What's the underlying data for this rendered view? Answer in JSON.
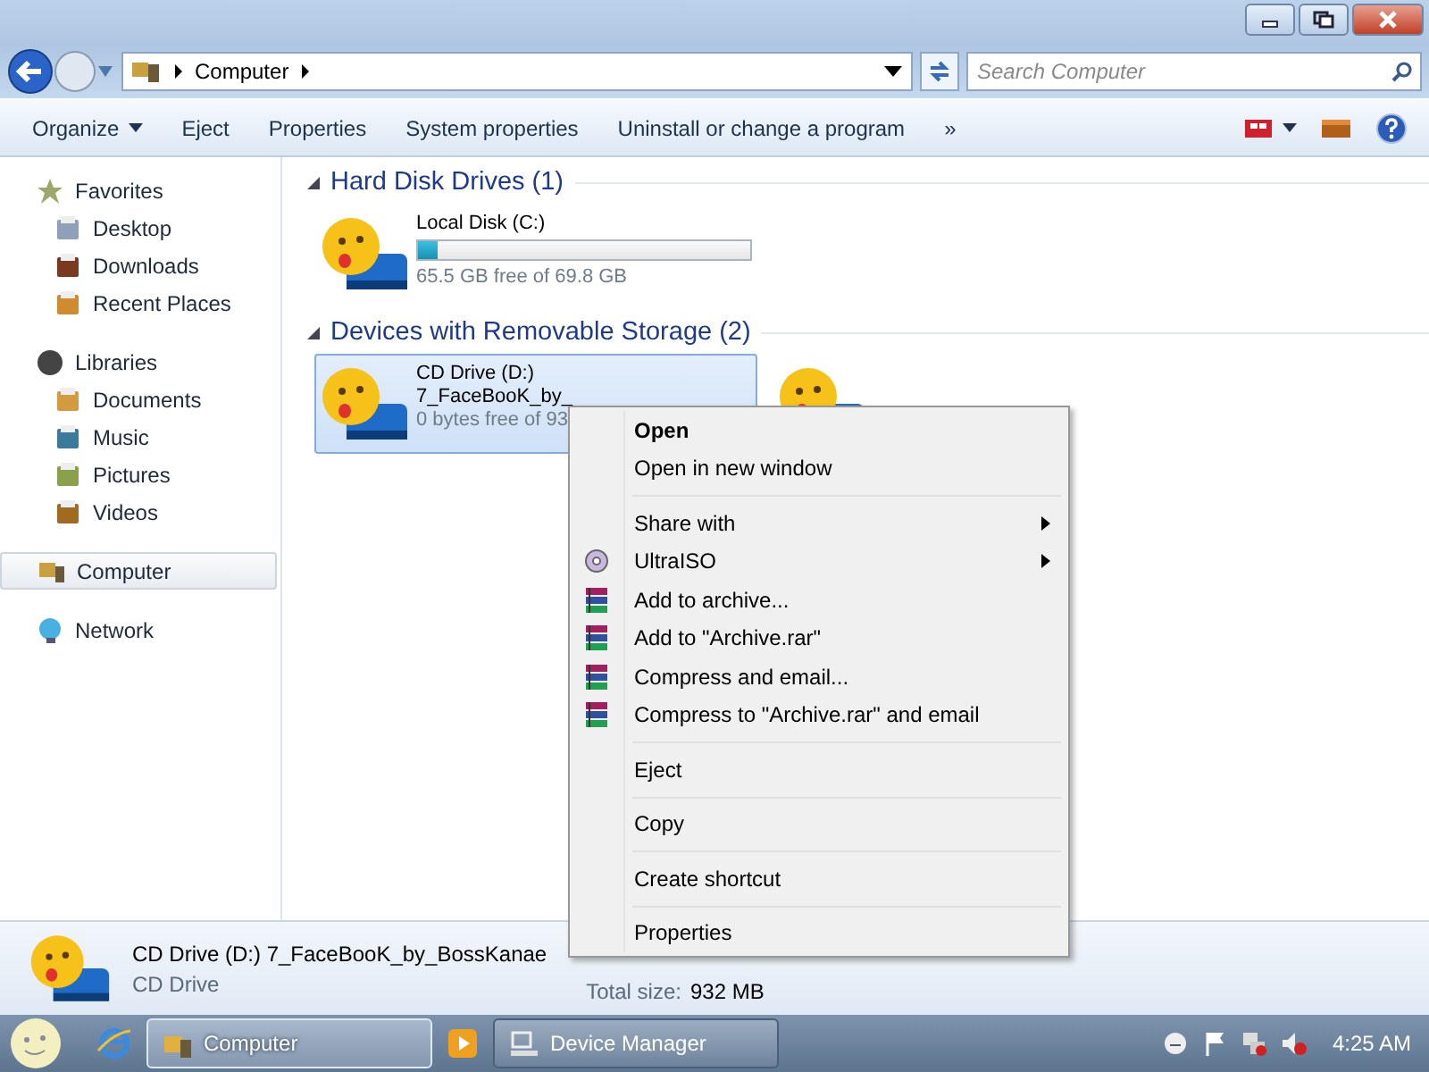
{
  "address_bar": {
    "path": [
      "Computer"
    ],
    "search_placeholder": "Search Computer"
  },
  "toolbar": {
    "buttons": [
      {
        "label": "Organize",
        "dropdown": true
      },
      {
        "label": "Eject",
        "dropdown": false
      },
      {
        "label": "Properties",
        "dropdown": false
      },
      {
        "label": "System properties",
        "dropdown": false
      },
      {
        "label": "Uninstall or change a program",
        "dropdown": false
      },
      {
        "label": "»",
        "dropdown": false
      }
    ]
  },
  "navigation": {
    "groups": [
      {
        "label": "Favorites",
        "kind": "star",
        "selected": false,
        "children": [
          {
            "label": "Desktop",
            "kind": "desktop",
            "selected": false
          },
          {
            "label": "Downloads",
            "kind": "downloads",
            "selected": false
          },
          {
            "label": "Recent Places",
            "kind": "recent",
            "selected": false
          }
        ]
      },
      {
        "label": "Libraries",
        "kind": "libraries",
        "selected": false,
        "children": [
          {
            "label": "Documents",
            "kind": "documents",
            "selected": false
          },
          {
            "label": "Music",
            "kind": "music",
            "selected": false
          },
          {
            "label": "Pictures",
            "kind": "pictures",
            "selected": false
          },
          {
            "label": "Videos",
            "kind": "videos",
            "selected": false
          }
        ]
      },
      {
        "label": "Computer",
        "kind": "computer",
        "selected": true
      },
      {
        "label": "Network",
        "kind": "network",
        "selected": false
      }
    ]
  },
  "sections": [
    {
      "title": "Hard Disk Drives (1)",
      "items": [
        {
          "name": "Local Disk (C:)",
          "detail": "65.5 GB free of 69.8 GB",
          "level": 0.06,
          "selected": false
        }
      ]
    },
    {
      "title": "Devices with Removable Storage (2)",
      "items": [
        {
          "name": "CD Drive (D:)",
          "lines": [
            "7_FaceBooK_by_"
          ],
          "detail": "0 bytes free of 93",
          "selected": true
        },
        {
          "selected": false
        }
      ]
    }
  ],
  "context_menu": {
    "groups": [
      [
        {
          "label": "Open",
          "kind": "plain",
          "default": true,
          "submenu": false
        },
        {
          "label": "Open in new window",
          "kind": "plain",
          "default": false,
          "submenu": false
        }
      ],
      [
        {
          "label": "Share with",
          "kind": "plain",
          "default": false,
          "submenu": true
        },
        {
          "label": "UltraISO",
          "kind": "disc",
          "default": false,
          "submenu": true
        },
        {
          "label": "Add to archive...",
          "kind": "archive",
          "default": false,
          "submenu": false
        },
        {
          "label": "Add to \"Archive.rar\"",
          "kind": "archive",
          "default": false,
          "submenu": false
        },
        {
          "label": "Compress and email...",
          "kind": "archive",
          "default": false,
          "submenu": false
        },
        {
          "label": "Compress to \"Archive.rar\" and email",
          "kind": "archive",
          "default": false,
          "submenu": false
        }
      ],
      [
        {
          "label": "Eject",
          "kind": "plain",
          "default": false,
          "submenu": false
        }
      ],
      [
        {
          "label": "Copy",
          "kind": "plain",
          "default": false,
          "submenu": false
        }
      ],
      [
        {
          "label": "Create shortcut",
          "kind": "plain",
          "default": false,
          "submenu": false
        }
      ],
      [
        {
          "label": "Properties",
          "kind": "plain",
          "default": false,
          "submenu": false
        }
      ]
    ]
  },
  "details_pane": {
    "title": "CD Drive (D:) 7_FaceBooK_by_BossKanae",
    "subtitle": "CD Drive",
    "fields": [
      {
        "label": "Total size:",
        "value": "932 MB"
      }
    ]
  },
  "taskbar": {
    "buttons": [
      {
        "label": "Computer",
        "kind": "explorer",
        "selected": true
      },
      {
        "label": "Device Manager",
        "kind": "device",
        "selected": false
      }
    ],
    "clock": "4:25 AM"
  }
}
